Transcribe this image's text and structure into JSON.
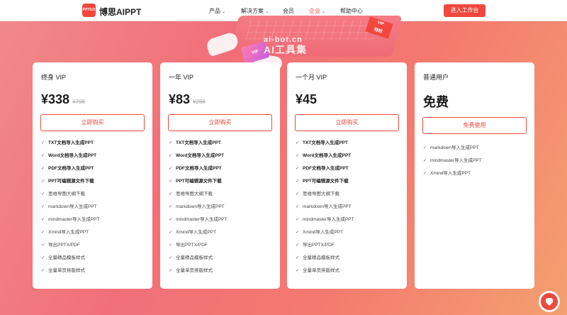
{
  "nav": {
    "logo_text": "PPTGO",
    "brand": "博思AIPPT",
    "items": [
      {
        "label": "产品",
        "caret": "⌄"
      },
      {
        "label": "解决方案",
        "caret": "⌄"
      },
      {
        "label": "会员",
        "caret": ""
      },
      {
        "label": "企业",
        "caret": "⌄"
      },
      {
        "label": "帮助中心",
        "caret": ""
      }
    ],
    "cta": "进入工作台"
  },
  "hero": {
    "vip_card": "VIP",
    "vip_tag_line1": "VIP",
    "vip_tag_line2": "特权",
    "watermark_line1": "ai-bot.cn",
    "watermark_line2": "AI工具集"
  },
  "plans": [
    {
      "title": "终身 VIP",
      "price": "¥338",
      "original": "¥798",
      "button": "立即购买",
      "features": [
        {
          "text": "TXT文档导入生成PPT",
          "bold": true
        },
        {
          "text": "Word文档导入生成PPT",
          "bold": true
        },
        {
          "text": "PDF文档导入生成PPT",
          "bold": true
        },
        {
          "text": "PPT可编辑源文件下载",
          "bold": true
        },
        {
          "text": "思维导图大纲下载",
          "bold": false
        },
        {
          "text": "markdown导入生成PPT",
          "bold": false
        },
        {
          "text": "mindmaster导入生成PPT",
          "bold": false
        },
        {
          "text": "Xmind导入生成PPT",
          "bold": false
        },
        {
          "text": "导出PPTX/PDF",
          "bold": false
        },
        {
          "text": "全量精品模板样式",
          "bold": false
        },
        {
          "text": "全量单页排版样式",
          "bold": false
        }
      ]
    },
    {
      "title": "一年 VIP",
      "price": "¥83",
      "original": "¥288",
      "button": "立即购买",
      "features": [
        {
          "text": "TXT文档导入生成PPT",
          "bold": true
        },
        {
          "text": "Word文档导入生成PPT",
          "bold": true
        },
        {
          "text": "PDF文档导入生成PPT",
          "bold": true
        },
        {
          "text": "PPT可编辑源文件下载",
          "bold": true
        },
        {
          "text": "思维导图大纲下载",
          "bold": false
        },
        {
          "text": "markdown导入生成PPT",
          "bold": false
        },
        {
          "text": "mindmaster导入生成PPT",
          "bold": false
        },
        {
          "text": "Xmind导入生成PPT",
          "bold": false
        },
        {
          "text": "导出PPTX/PDF",
          "bold": false
        },
        {
          "text": "全量精品模板样式",
          "bold": false
        },
        {
          "text": "全量单页排版样式",
          "bold": false
        }
      ]
    },
    {
      "title": "一个月 VIP",
      "price": "¥45",
      "original": "",
      "button": "立即购买",
      "features": [
        {
          "text": "TXT文档导入生成PPT",
          "bold": true
        },
        {
          "text": "Word文档导入生成PPT",
          "bold": true
        },
        {
          "text": "PDF文档导入生成PPT",
          "bold": true
        },
        {
          "text": "PPT可编辑源文件下载",
          "bold": true
        },
        {
          "text": "思维导图大纲下载",
          "bold": false
        },
        {
          "text": "markdown导入生成PPT",
          "bold": false
        },
        {
          "text": "mindmaster导入生成PPT",
          "bold": false
        },
        {
          "text": "Xmind导入生成PPT",
          "bold": false
        },
        {
          "text": "导出PPTX/PDF",
          "bold": false
        },
        {
          "text": "全量精品模板样式",
          "bold": false
        },
        {
          "text": "全量单页排版样式",
          "bold": false
        }
      ]
    }
  ],
  "free_plan": {
    "title": "普通用户",
    "price": "免费",
    "button": "免费使用",
    "features": [
      {
        "text": "markdown导入生成PPT"
      },
      {
        "text": "mindmaster导入生成PPT"
      },
      {
        "text": "Xmind导入生成PPT"
      }
    ]
  },
  "check_glyph": "✓",
  "colors": {
    "accent": "#e8473c",
    "background_start": "#f08a8a",
    "background_end": "#f4a070"
  }
}
